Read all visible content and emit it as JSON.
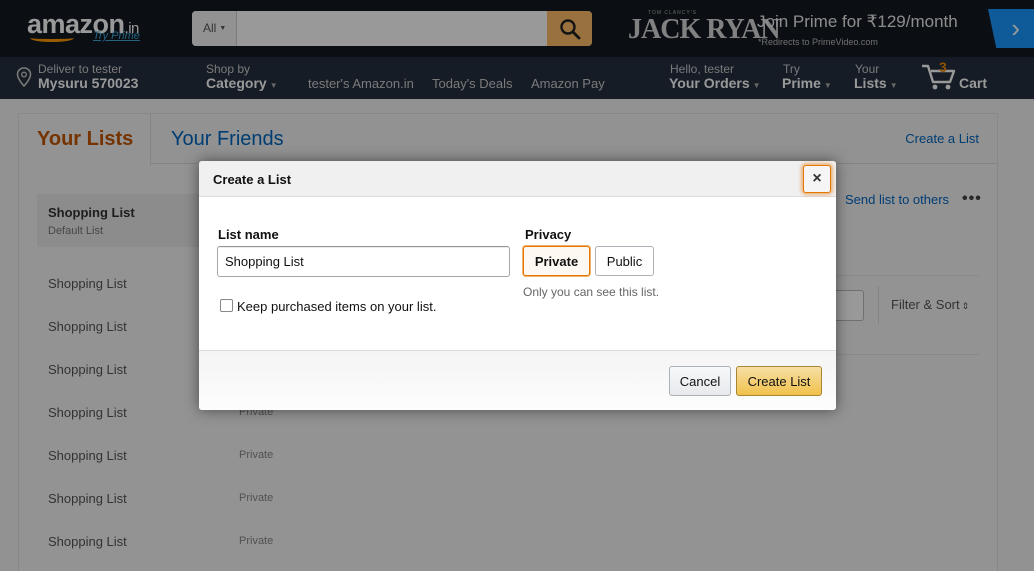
{
  "header": {
    "logo_text": "amazon",
    "logo_tld": ".in",
    "try_prime": "Try Prime",
    "search_category": "All",
    "search_placeholder": "",
    "promo_small": "TOM CLANCY'S",
    "promo_title": "JACK RYAN",
    "promo_join": "Join Prime for ₹129/month",
    "promo_sub": "*Redirects to PrimeVideo.com",
    "deliver_line1": "Deliver to tester",
    "deliver_line2": "Mysuru 570023",
    "shop_by_line1": "Shop by",
    "shop_by_line2": "Category",
    "links": [
      "tester's Amazon.in",
      "Today's Deals",
      "Amazon Pay"
    ],
    "orders_line1": "Hello, tester",
    "orders_line2": "Your Orders",
    "prime_line1": "Try",
    "prime_line2": "Prime",
    "lists_line1": "Your",
    "lists_line2": "Lists",
    "cart_count": "3",
    "cart_label": "Cart"
  },
  "page": {
    "tab_active": "Your Lists",
    "tab_other": "Your Friends",
    "create_link": "Create a List",
    "selected_list": {
      "title": "Shopping List",
      "subtitle": "Default List"
    },
    "side_items": [
      "Shopping List",
      "Shopping List",
      "Shopping List",
      "Shopping List",
      "Shopping List",
      "Shopping List",
      "Shopping List"
    ],
    "privacy_labels": [
      "Private",
      "Private",
      "Private",
      "Private"
    ],
    "send_to_others": "Send list to others",
    "more_dots": "•••",
    "filter_sort": "Filter & Sort"
  },
  "modal": {
    "title": "Create a List",
    "close_glyph": "×",
    "list_name_label": "List name",
    "list_name_value": "Shopping List",
    "keep_purchased_label": "Keep purchased items on your list.",
    "privacy_label": "Privacy",
    "privacy_private": "Private",
    "privacy_public": "Public",
    "privacy_note": "Only you can see this list.",
    "cancel_label": "Cancel",
    "create_label": "Create List"
  },
  "colors": {
    "header_bg": "#131921",
    "subnav_bg": "#232f3e",
    "accent_orange": "#e77600",
    "link_blue": "#0066c0",
    "primary_button": "#f0c14b"
  }
}
